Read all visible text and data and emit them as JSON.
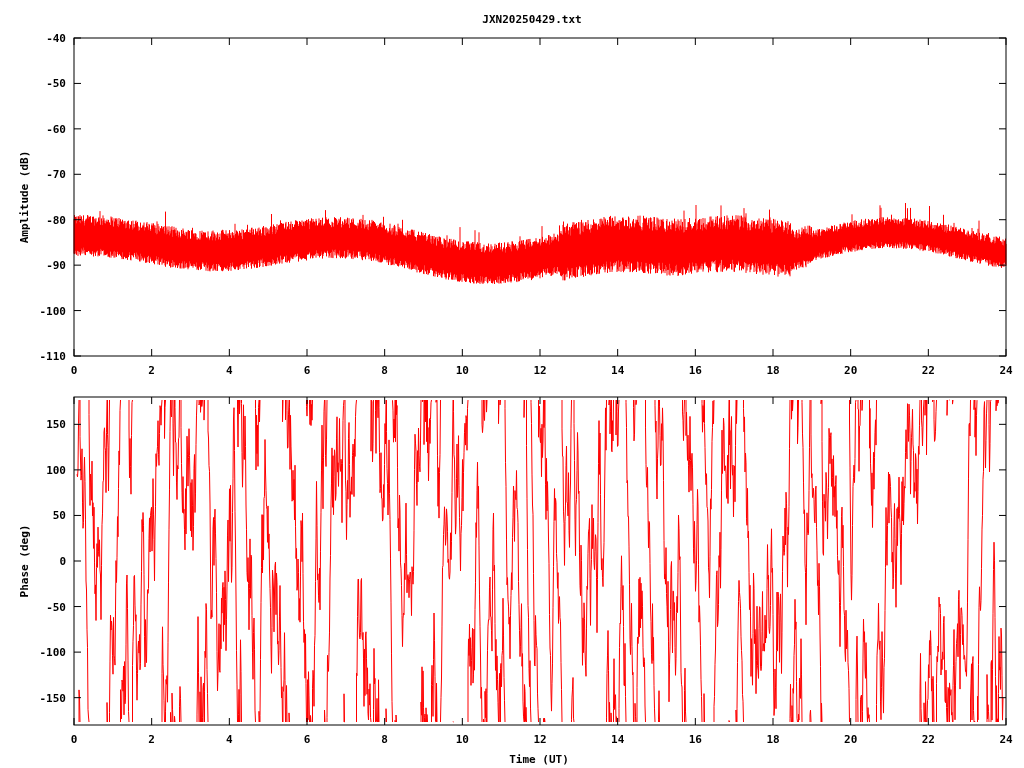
{
  "title": "JXN20250429.txt",
  "plots": [
    {
      "kind": "amplitude",
      "ylabel": "Amplitude (dB)",
      "yticks": [
        "-40",
        "-50",
        "-60",
        "-70",
        "-80",
        "-90",
        "-100",
        "-110"
      ],
      "xticks": [
        "0",
        "2",
        "4",
        "6",
        "8",
        "10",
        "12",
        "14",
        "16",
        "18",
        "20",
        "22",
        "24"
      ]
    },
    {
      "kind": "phase",
      "ylabel": "Phase (deg)",
      "yticks": [
        "150",
        "100",
        "50",
        "0",
        "-50",
        "-100",
        "-150"
      ],
      "xticks": [
        "0",
        "2",
        "4",
        "6",
        "8",
        "10",
        "12",
        "14",
        "16",
        "18",
        "20",
        "22",
        "24"
      ]
    }
  ],
  "xlabel": "Time (UT)"
}
